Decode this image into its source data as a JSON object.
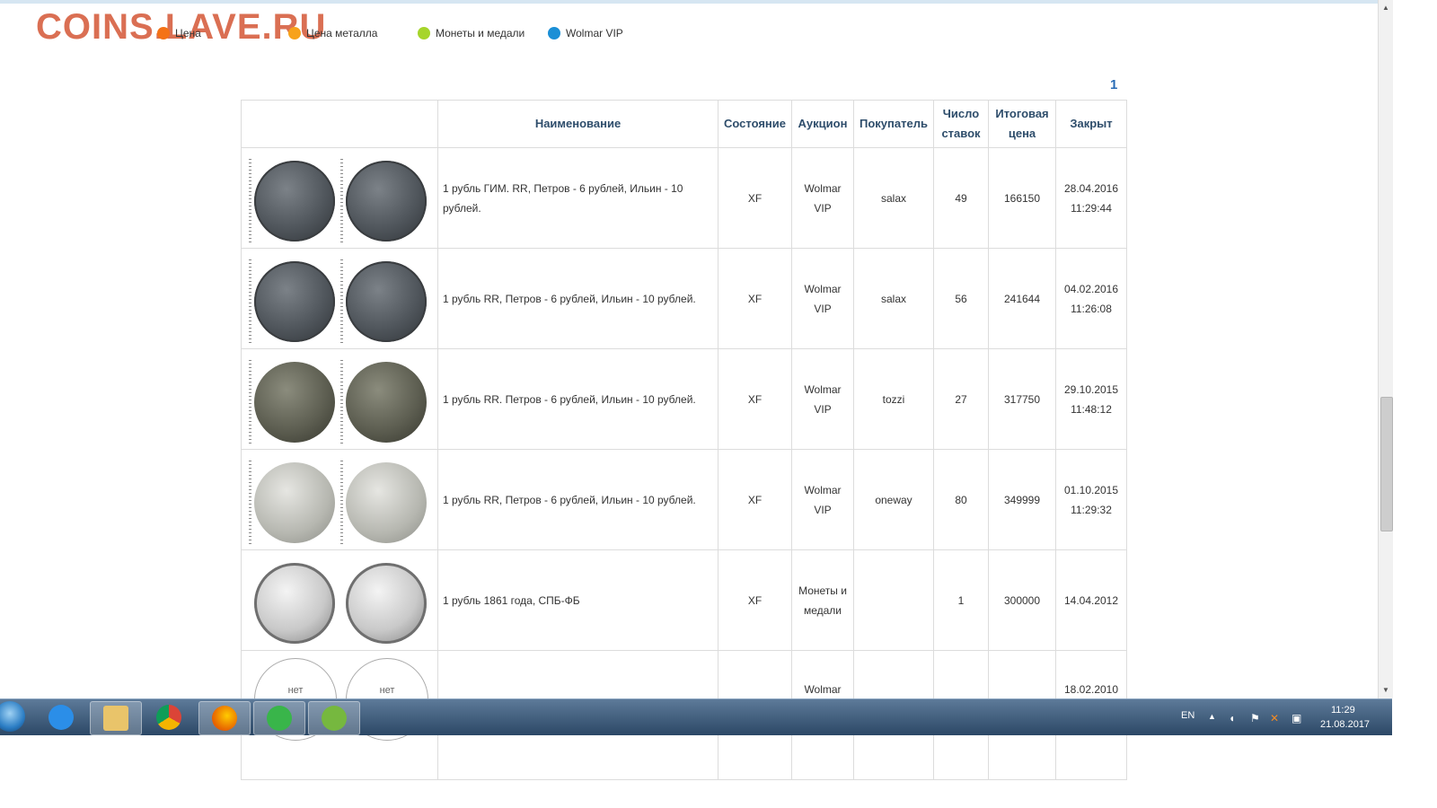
{
  "watermark": "COINS.LAVE.RU",
  "legend": [
    {
      "label": "Цена",
      "color": "#f47216"
    },
    {
      "label": "Цена металла",
      "color": "#f7a21b"
    },
    {
      "label": "Монеты и медали",
      "color": "#a6d52b"
    },
    {
      "label": "Wolmar VIP",
      "color": "#1b8fd6"
    }
  ],
  "pager": {
    "current": "1"
  },
  "table": {
    "headers": [
      "Наименование",
      "Состояние",
      "Аукцион",
      "Покупатель",
      "Число ставок",
      "Итоговая цена",
      "Закрыт"
    ],
    "rows": [
      {
        "name": "1 рубль ГИМ. RR, Петров - 6  рублей, Ильин - 10 рублей.",
        "condition": "XF",
        "auction": "Wolmar VIP",
        "buyer": "salax",
        "bids": "49",
        "price": "166150",
        "closed_date": "28.04.2016",
        "closed_time": "11:29:44",
        "coin_style": "dark"
      },
      {
        "name": "1 рубль RR, Петров - 6  рублей, Ильин - 10 рублей.",
        "condition": "XF",
        "auction": "Wolmar VIP",
        "buyer": "salax",
        "bids": "56",
        "price": "241644",
        "closed_date": "04.02.2016",
        "closed_time": "11:26:08",
        "coin_style": "dark"
      },
      {
        "name": "1 рубль RR. Петров - 6 рублей, Ильин - 10 рублей.",
        "condition": "XF",
        "auction": "Wolmar VIP",
        "buyer": "tozzi",
        "bids": "27",
        "price": "317750",
        "closed_date": "29.10.2015",
        "closed_time": "11:48:12",
        "coin_style": "mid"
      },
      {
        "name": "1 рубль RR, Петров - 6 рублей, Ильин - 10 рублей.",
        "condition": "XF",
        "auction": "Wolmar VIP",
        "buyer": "oneway",
        "bids": "80",
        "price": "349999",
        "closed_date": "01.10.2015",
        "closed_time": "11:29:32",
        "coin_style": "light"
      },
      {
        "name": "1 рубль 1861 года, СПБ-ФБ",
        "condition": "XF",
        "auction": "Монеты и медали",
        "buyer": "",
        "bids": "1",
        "price": "300000",
        "closed_date": "14.04.2012",
        "closed_time": "",
        "coin_style": "silver"
      },
      {
        "name": "",
        "condition": "",
        "auction": "Wolmar",
        "buyer": "",
        "bids": "",
        "price": "",
        "closed_date": "18.02.2010",
        "closed_time": "",
        "coin_style": "none",
        "no_image_label": "нет"
      }
    ]
  },
  "taskbar": {
    "apps": [
      {
        "name": "internet-explorer",
        "color": "#2b8ee8"
      },
      {
        "name": "file-explorer",
        "color": "#e9c46a"
      },
      {
        "name": "chrome",
        "color": "#db4437"
      },
      {
        "name": "firefox",
        "color": "#e66000"
      },
      {
        "name": "mail-agent",
        "color": "#39b54a"
      },
      {
        "name": "utorrent",
        "color": "#76b83f"
      }
    ],
    "language": "EN",
    "time": "11:29",
    "date": "21.08.2017"
  }
}
